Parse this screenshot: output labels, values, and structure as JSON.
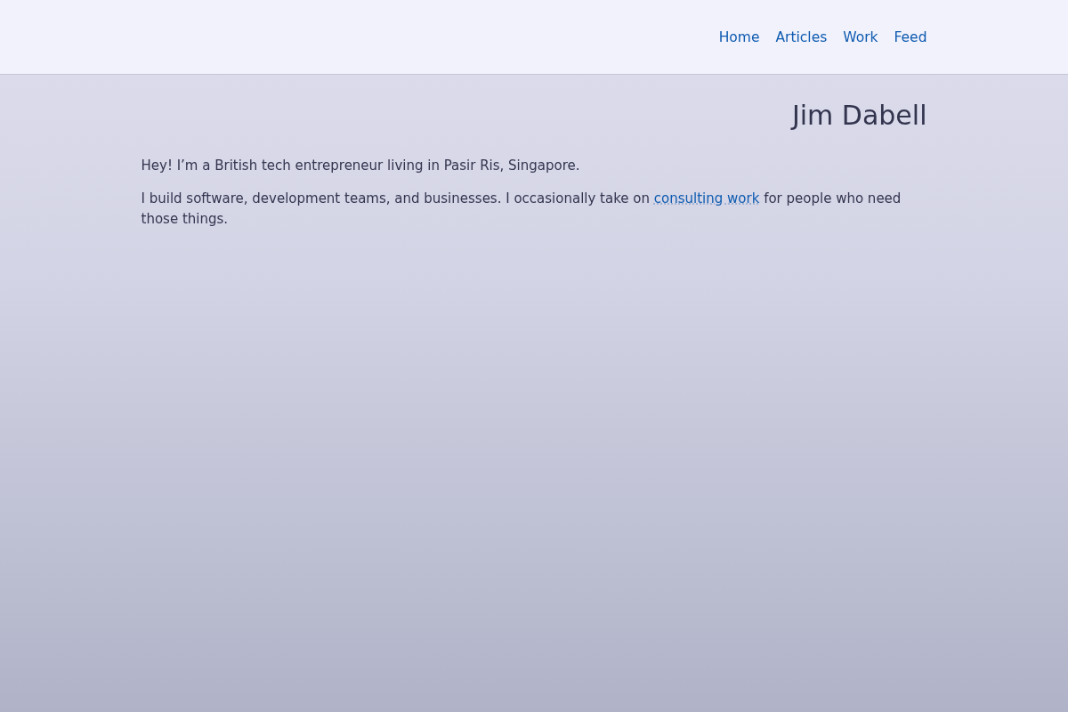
{
  "header": {
    "nav": [
      {
        "label": "Home"
      },
      {
        "label": "Articles"
      },
      {
        "label": "Work"
      },
      {
        "label": "Feed"
      }
    ]
  },
  "title": "Jim Dabell",
  "paragraphs": [
    {
      "segments": [
        {
          "kind": "text",
          "text": "Hey! I’m a British tech entrepreneur living in Pasir Ris, Singapore."
        }
      ]
    },
    {
      "segments": [
        {
          "kind": "text",
          "text": "I build software, development teams, and businesses. I occasionally take on "
        },
        {
          "kind": "link",
          "text": "consulting work"
        },
        {
          "kind": "text",
          "text": " for people who need those things."
        }
      ]
    }
  ]
}
